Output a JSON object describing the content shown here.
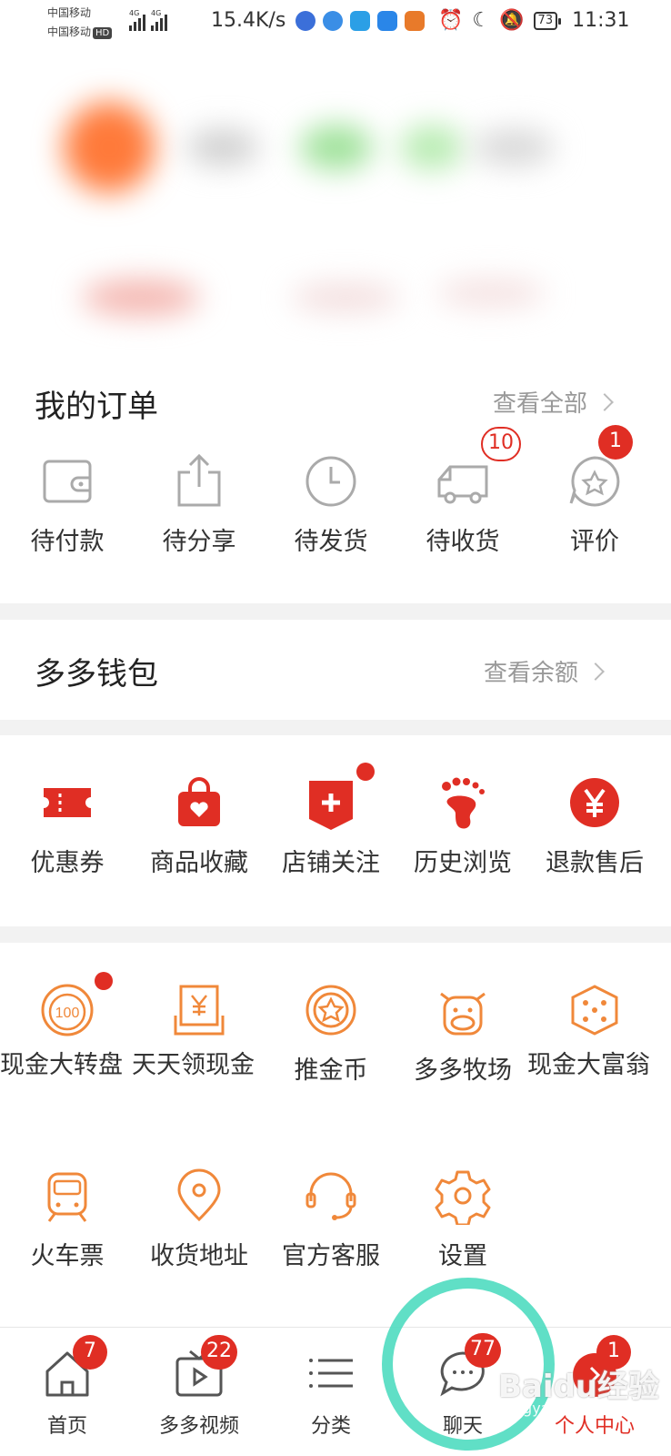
{
  "status_bar": {
    "carrier1": "中国移动",
    "carrier2": "中国移动",
    "hd": "HD",
    "net1": "4G",
    "net2": "4G",
    "speed": "15.4K/s",
    "battery": "73",
    "time": "11:31"
  },
  "orders": {
    "title": "我的订单",
    "more": "查看全部",
    "items": [
      {
        "label": "待付款",
        "icon": "wallet-icon"
      },
      {
        "label": "待分享",
        "icon": "share-icon"
      },
      {
        "label": "待发货",
        "icon": "clock-icon"
      },
      {
        "label": "待收货",
        "icon": "truck-icon",
        "badge": "10"
      },
      {
        "label": "评价",
        "icon": "review-icon",
        "badge": "1"
      }
    ]
  },
  "wallet": {
    "title": "多多钱包",
    "more": "查看余额"
  },
  "services": {
    "items": [
      {
        "label": "优惠券",
        "icon": "coupon-icon"
      },
      {
        "label": "商品收藏",
        "icon": "favorite-bag-icon"
      },
      {
        "label": "店铺关注",
        "icon": "store-follow-icon"
      },
      {
        "label": "历史浏览",
        "icon": "footprint-icon"
      },
      {
        "label": "退款售后",
        "icon": "refund-yen-icon"
      }
    ]
  },
  "tools": {
    "items": [
      {
        "label": "现金大转盘",
        "icon": "wheel-100-icon"
      },
      {
        "label": "天天领现金",
        "icon": "cash-envelope-icon"
      },
      {
        "label": "推金币",
        "icon": "coin-icon"
      },
      {
        "label": "多多牧场",
        "icon": "cow-icon"
      },
      {
        "label": "现金大富翁",
        "icon": "dice-icon"
      },
      {
        "label": "火车票",
        "icon": "train-icon"
      },
      {
        "label": "收货地址",
        "icon": "location-pin-icon"
      },
      {
        "label": "官方客服",
        "icon": "headset-icon"
      },
      {
        "label": "设置",
        "icon": "gear-icon"
      }
    ]
  },
  "nav": {
    "items": [
      {
        "label": "首页",
        "icon": "home-icon",
        "badge": "7"
      },
      {
        "label": "多多视频",
        "icon": "video-icon",
        "badge": "22"
      },
      {
        "label": "分类",
        "icon": "list-icon"
      },
      {
        "label": "聊天",
        "icon": "chat-icon",
        "badge": "77"
      },
      {
        "label": "个人中心",
        "icon": "profile-icon",
        "badge": "1"
      }
    ]
  },
  "watermark": {
    "brand": "Baidu经验",
    "sub": "jingyan.baidu.com"
  },
  "colors": {
    "accent": "#e02e24",
    "orange": "#f0883a",
    "annotation": "#4fdcc0"
  }
}
